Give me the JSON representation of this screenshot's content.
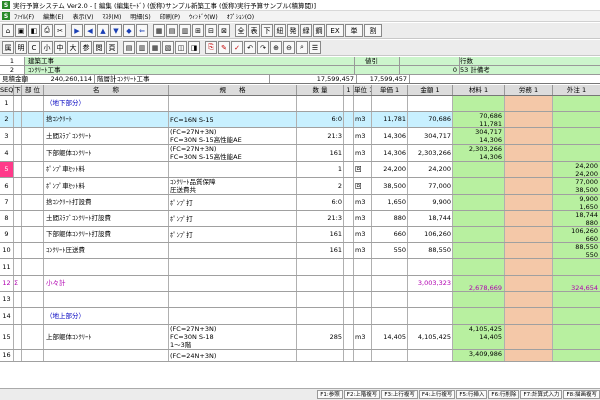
{
  "window": {
    "title": "実行予算システム Ver2.0 - [ 編集 (編集ﾓｰﾄﾞ) (仮称)サンプル新築工事 (仮称)実行予算サンプル(積算閲)]"
  },
  "menu": [
    "ﾌｧｲﾙ(F)",
    "編集(E)",
    "表示(V)",
    "ﾏｽﾀ(M)",
    "明細(S)",
    "印刷(P)",
    "ｳｨﾝﾄﾞｳ(W)",
    "ｵﾌﾟｼｮﾝ(O)"
  ],
  "toolbar1": {
    "left_glyphs": [
      "▶",
      "◀",
      "▲",
      "▼",
      "◆",
      "⇐"
    ],
    "labels": [
      "全",
      "表",
      "下",
      "紐",
      "発",
      "緑",
      "鋼",
      "EX",
      "単",
      "割"
    ]
  },
  "toolbar2": {
    "labels": [
      "属",
      "明",
      "C",
      "小",
      "中",
      "大",
      "参",
      "閲",
      "頁"
    ]
  },
  "header": {
    "row1": {
      "num": "1",
      "name": "建築工事",
      "lbl": "値引",
      "val": "",
      "rest": "行数"
    },
    "row2": {
      "num": "2",
      "name": "ｺﾝｸﾘｰﾄ工事",
      "val": "0",
      "rest": "53 計備考"
    }
  },
  "summary": {
    "label": "見積金額",
    "amount": "240,260,114",
    "sublabel": "階層計",
    "subname": "ｺﾝｸﾘｰﾄ工事",
    "total1": "17,599,457",
    "total2": "17,599,457"
  },
  "columns": [
    "SEQ",
    "下",
    "部 位",
    "名　　称",
    "規　　格",
    "数 量",
    "1",
    "単位 1",
    "単価 1",
    "金額 1",
    "材料 1",
    "労務 1",
    "外注 1"
  ],
  "rows": [
    {
      "seq": "1",
      "name": "（地下部分）",
      "name_class": "blue",
      "spec": [
        ""
      ],
      "qty": "",
      "unit": "",
      "up": "",
      "amt": "",
      "mat": [
        "",
        ""
      ],
      "lab": [
        "",
        ""
      ],
      "out": [
        "",
        ""
      ],
      "h": 16
    },
    {
      "seq": "2",
      "name": "捨ｺﾝｸﾘｰﾄ",
      "spec": [
        "FC=16N S-15"
      ],
      "qty": "6:0",
      "unit": "m3",
      "up": "11,781",
      "amt": "70,686",
      "mat": [
        "70,686",
        "11,781"
      ],
      "lab": [
        "",
        ""
      ],
      "out": [
        "",
        ""
      ],
      "h": 16,
      "bg": "row2bg"
    },
    {
      "seq": "3",
      "name": "土間ｽﾗﾌﾞｺﾝｸﾘｰﾄ",
      "spec": [
        "(FC=27N+3N)",
        "FC=30N S-15高性能AE"
      ],
      "qty": "21:3",
      "unit": "m3",
      "up": "14,306",
      "amt": "304,717",
      "mat": [
        "304,717",
        "14,306"
      ],
      "lab": [
        "",
        ""
      ],
      "out": [
        "",
        ""
      ],
      "h": 17
    },
    {
      "seq": "4",
      "name": "下部躯体ｺﾝｸﾘｰﾄ",
      "spec": [
        "(FC=27N+3N)",
        "FC=30N S-15高性能AE"
      ],
      "qty": "161",
      "unit": "m3",
      "up": "14,306",
      "amt": "2,303,266",
      "mat": [
        "2,303,266",
        "14,306"
      ],
      "lab": [
        "",
        ""
      ],
      "out": [
        "",
        ""
      ],
      "h": 17
    },
    {
      "seq": "5",
      "name": "ﾎﾟﾝﾌﾟ車ｾｯﾄ料",
      "spec": [
        ""
      ],
      "qty": "1",
      "unit": "回",
      "up": "24,200",
      "amt": "24,200",
      "mat": [
        "",
        ""
      ],
      "lab": [
        "",
        ""
      ],
      "out": [
        "24,200",
        "24,200"
      ],
      "h": 16,
      "seqbadge": true
    },
    {
      "seq": "6",
      "name": "ﾎﾟﾝﾌﾟ車ｾｯﾄ料",
      "spec": [
        "ｺﾝｸﾘｰﾄ品質保障",
        "圧送費共"
      ],
      "qty": "2",
      "unit": "回",
      "up": "38,500",
      "amt": "77,000",
      "mat": [
        "",
        ""
      ],
      "lab": [
        "",
        ""
      ],
      "out": [
        "77,000",
        "38,500"
      ],
      "h": 17
    },
    {
      "seq": "7",
      "name": "捨ｺﾝｸﾘｰﾄ打設費",
      "spec": [
        "ﾎﾟﾝﾌﾟ打"
      ],
      "qty": "6:0",
      "unit": "m3",
      "up": "1,650",
      "amt": "9,900",
      "mat": [
        "",
        ""
      ],
      "lab": [
        "",
        ""
      ],
      "out": [
        "9,900",
        "1,650"
      ],
      "h": 16
    },
    {
      "seq": "8",
      "name": "土間ｽﾗﾌﾞｺﾝｸﾘｰﾄ打設費",
      "spec": [
        "ﾎﾟﾝﾌﾟ打"
      ],
      "qty": "21:3",
      "unit": "m3",
      "up": "880",
      "amt": "18,744",
      "mat": [
        "",
        ""
      ],
      "lab": [
        "",
        ""
      ],
      "out": [
        "18,744",
        "880"
      ],
      "h": 16
    },
    {
      "seq": "9",
      "name": "下部躯体ｺﾝｸﾘｰﾄ打設費",
      "spec": [
        "ﾎﾟﾝﾌﾟ打"
      ],
      "qty": "161",
      "unit": "m3",
      "up": "660",
      "amt": "106,260",
      "mat": [
        "",
        ""
      ],
      "lab": [
        "",
        ""
      ],
      "out": [
        "106,260",
        "660"
      ],
      "h": 16
    },
    {
      "seq": "10",
      "name": "ｺﾝｸﾘｰﾄ圧送費",
      "spec": [
        ""
      ],
      "qty": "161",
      "unit": "m3",
      "up": "550",
      "amt": "88,550",
      "mat": [
        "",
        ""
      ],
      "lab": [
        "",
        ""
      ],
      "out": [
        "88,550",
        "550"
      ],
      "h": 16
    },
    {
      "seq": "11",
      "name": "",
      "spec": [
        ""
      ],
      "qty": "",
      "unit": "",
      "up": "",
      "amt": "",
      "mat": [
        "",
        ""
      ],
      "lab": [
        "",
        ""
      ],
      "out": [
        "",
        ""
      ],
      "h": 17
    },
    {
      "seq": "12",
      "down": "Σ",
      "name": "小々計",
      "name_class": "magenta",
      "spec": [
        ""
      ],
      "qty": "",
      "unit": "",
      "up": "",
      "amt": "3,003,323",
      "amt_class": "magenta",
      "mat": [
        "",
        "2,678,669"
      ],
      "mat_class": "magenta",
      "lab": [
        "",
        ""
      ],
      "out": [
        "",
        "324,654"
      ],
      "out_class": "magenta",
      "h": 16,
      "seq_class": "magenta"
    },
    {
      "seq": "13",
      "name": "",
      "spec": [
        ""
      ],
      "qty": "",
      "unit": "",
      "up": "",
      "amt": "",
      "mat": [
        "",
        ""
      ],
      "lab": [
        "",
        ""
      ],
      "out": [
        "",
        ""
      ],
      "h": 16
    },
    {
      "seq": "14",
      "name": "（地上部分）",
      "name_class": "blue",
      "spec": [
        ""
      ],
      "qty": "",
      "unit": "",
      "up": "",
      "amt": "",
      "mat": [
        "",
        ""
      ],
      "lab": [
        "",
        ""
      ],
      "out": [
        "",
        ""
      ],
      "h": 17
    },
    {
      "seq": "15",
      "name": "上部躯体ｺﾝｸﾘｰﾄ",
      "spec": [
        "(FC=27N+3N)",
        "FC=30N S-18",
        "1～3階"
      ],
      "qty": "285",
      "unit": "m3",
      "up": "14,405",
      "amt": "4,105,425",
      "mat": [
        "4,105,425",
        "14,405"
      ],
      "lab": [
        "",
        ""
      ],
      "out": [
        "",
        ""
      ],
      "h": 25
    },
    {
      "seq": "16",
      "name": "",
      "spec": [
        "(FC=24N+3N)"
      ],
      "qty": "",
      "unit": "",
      "up": "",
      "amt": "",
      "mat": [
        "3,409,986",
        ""
      ],
      "lab": [
        "",
        ""
      ],
      "out": [
        "",
        ""
      ],
      "h": 12
    }
  ],
  "function_keys": [
    "F1:参照",
    "F2:上階複写",
    "F3:上行複写",
    "F4:上行複写",
    "F5:行挿入",
    "F6:行削除",
    "F7:計算式入力",
    "F8:描画複写"
  ],
  "colors": {
    "material": "#b8f0a0",
    "labor": "#f4c8a8",
    "outsourcing": "#b8f0a0",
    "header_green": "#ccf5cc",
    "selected_row": "#c8f0ff",
    "seq_badge": "#ff3a8a"
  }
}
